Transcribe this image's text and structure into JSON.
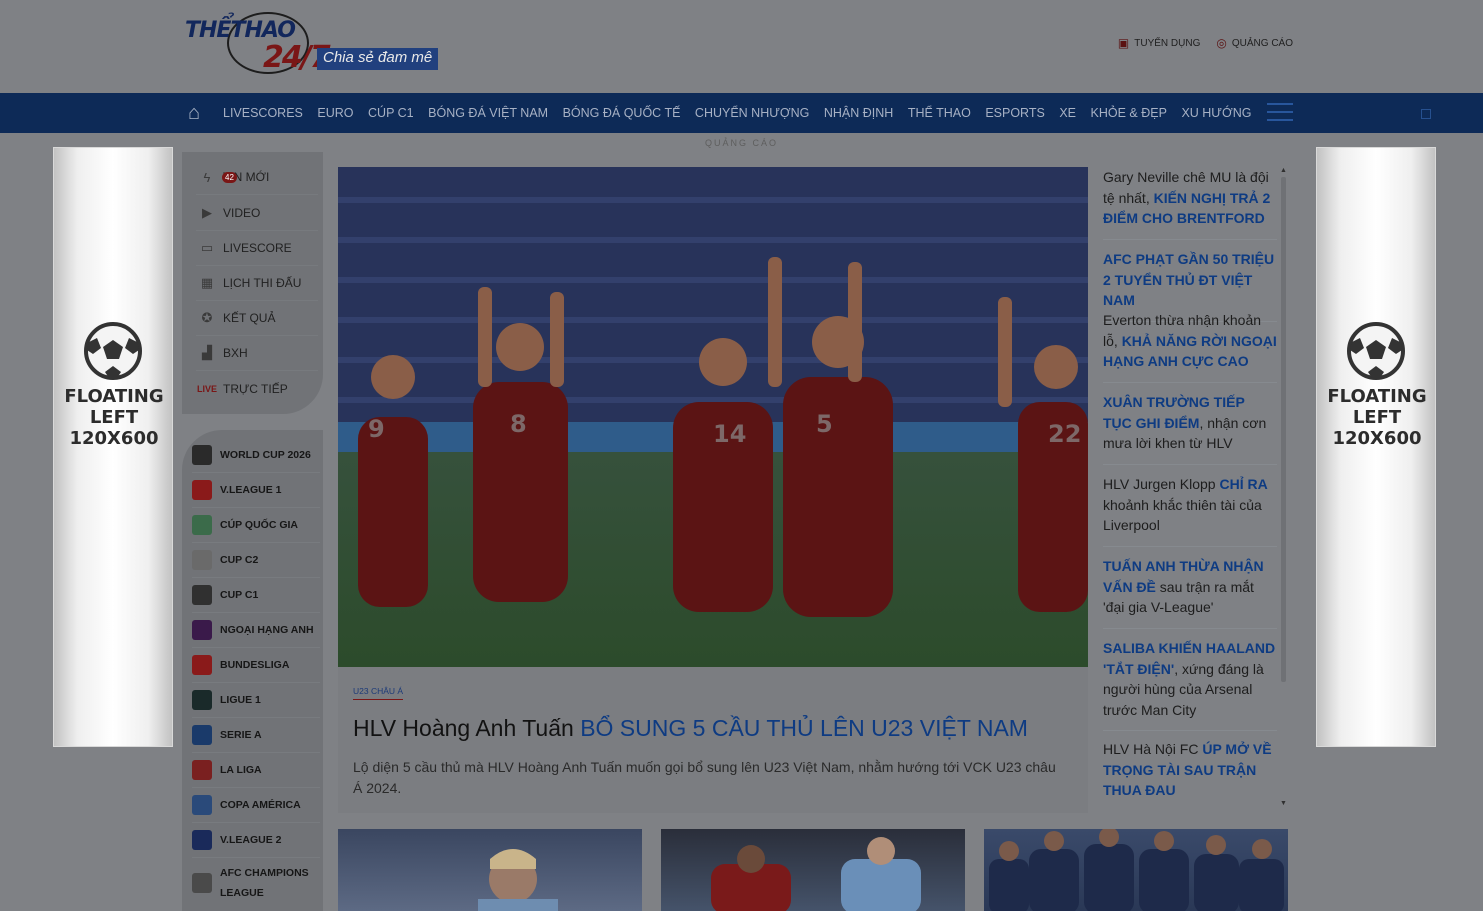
{
  "header": {
    "brand_top": "THỂTHAO",
    "brand_num": "24/7",
    "slogan": "Chia sẻ đam mê",
    "links": [
      {
        "label": "TUYỂN DỤNG",
        "icon": "briefcase-icon"
      },
      {
        "label": "QUẢNG CÁO",
        "icon": "target-icon"
      }
    ]
  },
  "nav": {
    "home_icon": "home-icon",
    "items": [
      "LIVESCORES",
      "EURO",
      "CÚP C1",
      "BÓNG ĐÁ VIỆT NAM",
      "BÓNG ĐÁ QUỐC TẾ",
      "CHUYỂN NHƯỢNG",
      "NHẬN ĐỊNH",
      "THỂ THAO",
      "ESPORTS",
      "XE",
      "KHỎE & ĐẸP",
      "XU HƯỚNG"
    ]
  },
  "ad_label": "QUẢNG CÁO",
  "floaters": {
    "left": {
      "line1": "FLOATING",
      "line2": "LEFT",
      "line3": "120X600"
    },
    "right": {
      "line1": "FLOATING",
      "line2": "LEFT",
      "line3": "120X600"
    }
  },
  "side_menu": {
    "items": [
      {
        "label": "TIN MỚI",
        "icon": "flash-icon",
        "badge": "42"
      },
      {
        "label": "VIDEO",
        "icon": "video-icon"
      },
      {
        "label": "LIVESCORE",
        "icon": "scoreboard-icon"
      },
      {
        "label": "LỊCH THI ĐẤU",
        "icon": "calendar-icon"
      },
      {
        "label": "KẾT QUẢ",
        "icon": "result-icon"
      },
      {
        "label": "BXH",
        "icon": "ranking-icon"
      },
      {
        "label": "TRỰC TIẾP",
        "icon": "live-icon"
      }
    ]
  },
  "leagues": [
    {
      "label": "WORLD CUP 2026",
      "color": "#2a2a2a"
    },
    {
      "label": "V.LEAGUE 1",
      "color": "#8a1a1a"
    },
    {
      "label": "CÚP QUỐC GIA",
      "color": "#3b6b4a"
    },
    {
      "label": "CUP C2",
      "color": "#6a6a6a"
    },
    {
      "label": "CUP C1",
      "color": "#303030"
    },
    {
      "label": "NGOẠI HẠNG ANH",
      "color": "#3a1a4a"
    },
    {
      "label": "BUNDESLIGA",
      "color": "#8a1a1a"
    },
    {
      "label": "LIGUE 1",
      "color": "#1a2a2a"
    },
    {
      "label": "SERIE A",
      "color": "#1a3a6a"
    },
    {
      "label": "LA LIGA",
      "color": "#7a2020"
    },
    {
      "label": "COPA AMÉRICA",
      "color": "#2a4a7a"
    },
    {
      "label": "V.LEAGUE 2",
      "color": "#1a2a5a"
    },
    {
      "label": "AFC CHAMPIONS LEAGUE",
      "color": "#4a4a4a"
    }
  ],
  "hero": {
    "tag": "U23 CHÂU Á",
    "title_plain": "HLV Hoàng Anh Tuấn ",
    "title_highlight": "BỔ SUNG 5 CẦU THỦ LÊN U23 VIỆT NAM",
    "description": "Lộ diện 5 cầu thủ mà HLV Hoàng Anh Tuấn muốn gọi bổ sung lên U23 Việt Nam, nhằm hướng tới VCK U23 châu Á 2024.",
    "jerseys": [
      "9",
      "8",
      "14",
      "5",
      "22"
    ]
  },
  "feed": [
    {
      "pre": "Gary Neville chê MU là đội tệ nhất, ",
      "hl": "KIẾN NGHỊ TRẢ 2 ĐIỂM CHO BRENTFORD",
      "post": ""
    },
    {
      "pre": "",
      "hl": "AFC PHẠT GẦN 50 TRIỆU 2 TUYỂN THỦ ĐT VIỆT NAM",
      "post": ""
    },
    {
      "pre": "Everton thừa nhận khoản lỗ, ",
      "hl": "KHẢ NĂNG RỜI NGOẠI HẠNG ANH CỰC CAO",
      "post": ""
    },
    {
      "pre": "",
      "hl": "XUÂN TRƯỜNG TIẾP TỤC GHI ĐIỂM",
      "post": ", nhận cơn mưa lời khen từ HLV"
    },
    {
      "pre": "HLV Jurgen Klopp ",
      "hl": "CHỈ RA",
      "post": " khoảnh khắc thiên tài của Liverpool"
    },
    {
      "pre": "",
      "hl": "TUẤN ANH THỪA NHẬN VẤN ĐỀ",
      "post": " sau trận ra mắt 'đại gia V-League'"
    },
    {
      "pre": "",
      "hl": "SALIBA KHIẾN HAALAND 'TẮT ĐIỆN'",
      "post": ", xứng đáng là người hùng của Arsenal trước Man City"
    },
    {
      "pre": "HLV Hà Nội FC ",
      "hl": "ÚP MỞ VỀ TRỌNG TÀI SAU TRẬN THUA ĐAU",
      "post": ""
    }
  ]
}
